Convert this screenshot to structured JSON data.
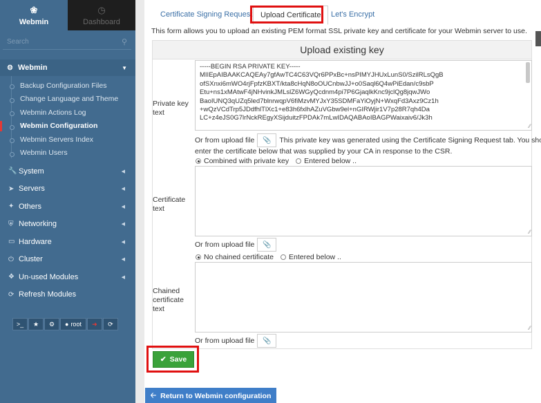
{
  "sidebar": {
    "tabs": [
      {
        "label": "Webmin",
        "icon": "webmin-logo-icon"
      },
      {
        "label": "Dashboard",
        "icon": "dashboard-icon"
      }
    ],
    "search_placeholder": "Search",
    "section": {
      "label": "Webmin",
      "icon": "gear-icon"
    },
    "subitems": [
      {
        "label": "Backup Configuration Files"
      },
      {
        "label": "Change Language and Theme"
      },
      {
        "label": "Webmin Actions Log"
      },
      {
        "label": "Webmin Configuration"
      },
      {
        "label": "Webmin Servers Index"
      },
      {
        "label": "Webmin Users"
      }
    ],
    "menu": [
      {
        "label": "System",
        "icon": "wrench-icon"
      },
      {
        "label": "Servers",
        "icon": "rocket-icon"
      },
      {
        "label": "Others",
        "icon": "tools-icon"
      },
      {
        "label": "Networking",
        "icon": "shield-icon"
      },
      {
        "label": "Hardware",
        "icon": "hdd-icon"
      },
      {
        "label": "Cluster",
        "icon": "power-icon"
      },
      {
        "label": "Un-used Modules",
        "icon": "puzzle-icon"
      },
      {
        "label": "Refresh Modules",
        "icon": "refresh-icon"
      }
    ],
    "toolbar": {
      "terminal": ">_",
      "user": "root"
    }
  },
  "tabs": [
    "Certificate Signing Request",
    "Upload Certificate",
    "Let's Encrypt"
  ],
  "info": "This form allows you to upload an existing PEM format SSL private key and certificate for your Webmin server to use.",
  "form": {
    "title": "Upload existing key",
    "private_key_label": "Private key text",
    "private_key_text": "-----BEGIN RSA PRIVATE KEY-----\nMIIEpAIBAAKCAQEAy7gfAwTC4C63VQr6PPxBc+nsPIMYJHUxLunS0/SzilRLsQgB\nofSXnxi6mWO4rjFpfzKBXT/kta8cHqN8oOUCnbwJJ+o0Saql6Q4wPiEdan/c9sbP\nEtu+ns1xMAtwF4jNHvinkJMLslZ6WGyQcdnm4pi7P6GjaqlkKnc9jclQg8jqwJWo\nBaoIUNQ3qUZq5led7blnrwqpV6fiMzvMYJxY35SDMFaYiOyjN+WxqFd3Axz9Cz1h\n+wQzVCdTrp5JDdfhlTlXc1+e83h6fxlhAZuVGbw9el+nGIRWjir1V7p28R7qh4Da\nLC+z4eJS0G7lrNckREgyXSijduitzFPDAk7mLwIDAQABAoIBAGPWaixaiv6/Jk3h",
    "private_key_upload": "Or from upload file",
    "csr_note": "This private key was generated using the Certificate Signing Request tab. You should",
    "csr_note2": "enter the certificate below that was supplied by your CA in response to the CSR.",
    "cert_opt1": "Combined with private key",
    "cert_opt2": "Entered below ..",
    "cert_label": "Certificate text",
    "cert_upload": "Or from upload file",
    "chain_opt1": "No chained certificate",
    "chain_opt2": "Entered below ..",
    "chain_label": "Chained certificate text",
    "chain_upload": "Or from upload file"
  },
  "buttons": {
    "save": "Save",
    "return": "Return to Webmin configuration"
  },
  "colors": {
    "sidebar": "#426b8f",
    "highlight": "#e01010",
    "save": "#3aa23a",
    "return": "#3f7ec8"
  }
}
